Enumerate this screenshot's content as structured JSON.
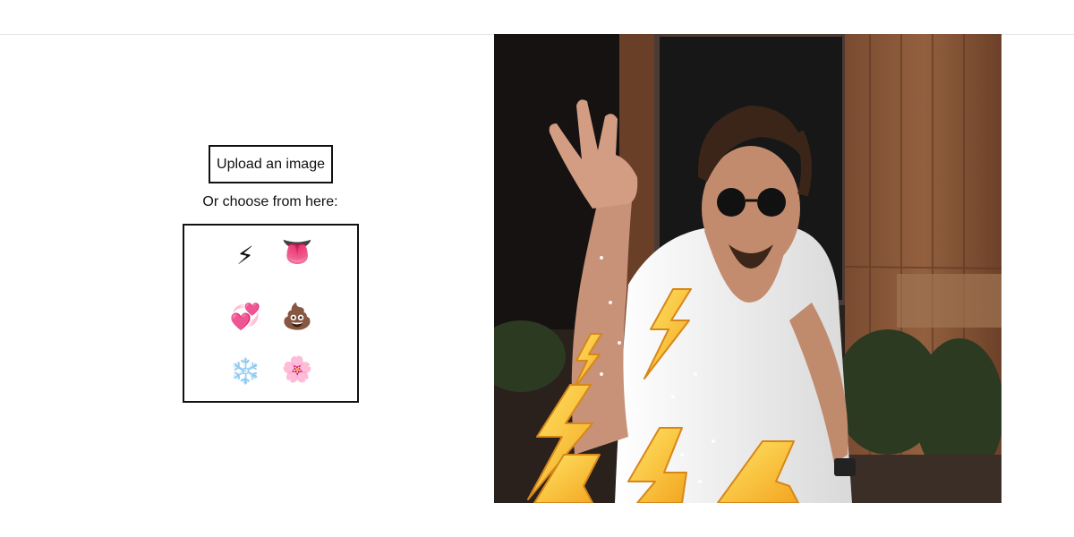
{
  "upload": {
    "label": "Upload an image"
  },
  "chooser": {
    "label": "Or choose from here:",
    "emojis": [
      {
        "name": "high-voltage",
        "glyph": "⚡"
      },
      {
        "name": "tongue",
        "glyph": "👅"
      },
      {
        "name": "heart-with-ribbon",
        "glyph": "💞"
      },
      {
        "name": "pile-of-poo",
        "glyph": "💩"
      },
      {
        "name": "snowflake",
        "glyph": "❄️"
      },
      {
        "name": "cherry-blossom",
        "glyph": "🌸"
      }
    ]
  },
  "colors": {
    "wood": "#8a5a3c",
    "wood_dark": "#5a3724",
    "window": "#1c1a1a",
    "skin": "#c79277",
    "shirt": "#f4f4f4",
    "hair": "#3a2518",
    "bolt": "#f7c427",
    "bolt_edge": "#d6871a"
  }
}
